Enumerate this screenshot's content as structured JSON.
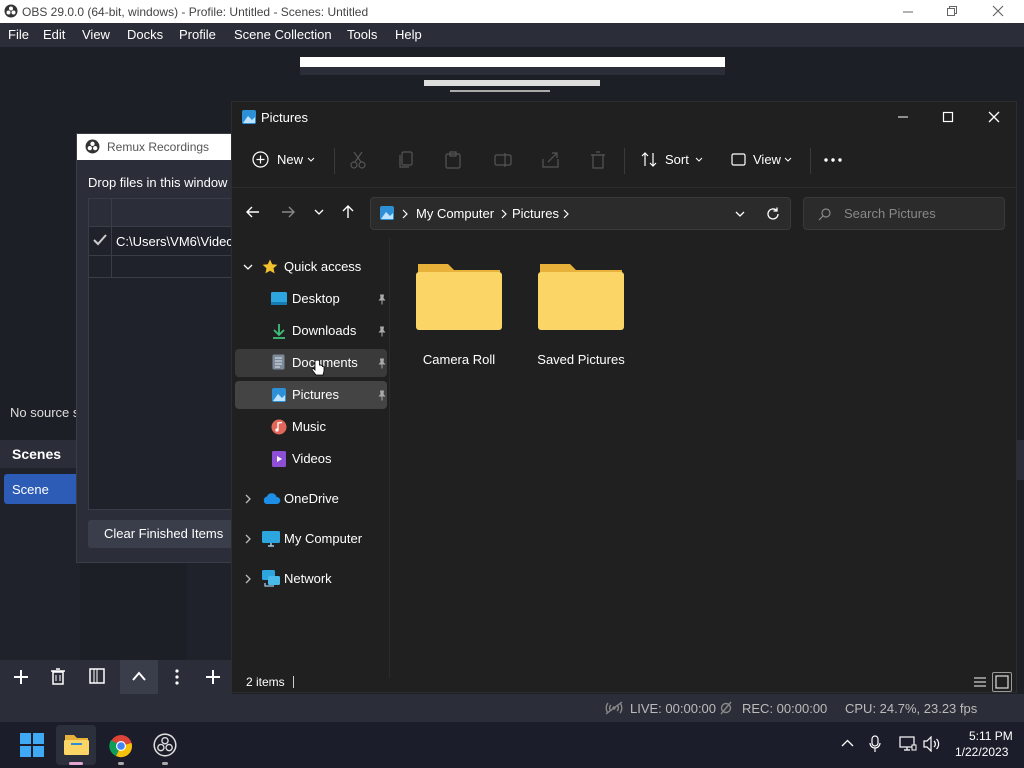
{
  "obs": {
    "title": "OBS 29.0.0 (64-bit, windows) - Profile: Untitled - Scenes: Untitled",
    "menu": [
      "File",
      "Edit",
      "View",
      "Docks",
      "Profile",
      "Scene Collection",
      "Tools",
      "Help"
    ],
    "no_source": "No source s",
    "scenes_header": "Scenes",
    "scene_item": "Scene",
    "status": {
      "live": "LIVE: 00:00:00",
      "rec": "REC: 00:00:00",
      "cpu": "CPU: 24.7%, 23.23 fps"
    }
  },
  "remux": {
    "title": "Remux Recordings",
    "drop_text": "Drop files in this window",
    "row_path": "C:\\Users\\VM6\\Videc",
    "clear_button": "Clear Finished Items"
  },
  "explorer": {
    "title": "Pictures",
    "toolbar": {
      "new": "New",
      "sort": "Sort",
      "view": "View"
    },
    "breadcrumb": [
      "My Computer",
      "Pictures"
    ],
    "search_placeholder": "Search Pictures",
    "nav": {
      "quick_access": "Quick access",
      "desktop": "Desktop",
      "downloads": "Downloads",
      "documents": "Documents",
      "pictures": "Pictures",
      "music": "Music",
      "videos": "Videos",
      "onedrive": "OneDrive",
      "my_computer": "My Computer",
      "network": "Network"
    },
    "folders": [
      "Camera Roll",
      "Saved Pictures"
    ],
    "status": "2 items"
  },
  "taskbar": {
    "time": "5:11 PM",
    "date": "1/22/2023"
  }
}
